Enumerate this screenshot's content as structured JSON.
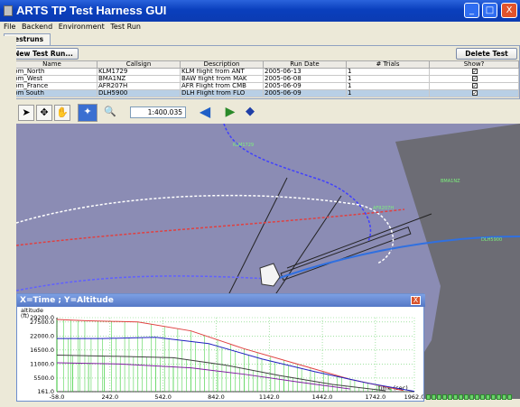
{
  "window": {
    "title": "ARTS TP Test Harness GUI",
    "buttons": {
      "minimize": "_",
      "maximize": "□",
      "close": "X"
    }
  },
  "menu": [
    {
      "label": "File"
    },
    {
      "label": "Backend"
    },
    {
      "label": "Environment"
    },
    {
      "label": "Test Run"
    }
  ],
  "tabs": [
    {
      "label": "Testruns"
    }
  ],
  "runs_panel": {
    "new_button": "New Test Run...",
    "delete_button": "Delete Test Run...",
    "columns": [
      "Name",
      "Callsign",
      "Description",
      "Run Date",
      "# Trials",
      "Show?"
    ],
    "rows": [
      {
        "name": "From_North",
        "callsign": "KLM1729",
        "description": "KLM flight from ANT",
        "date": "2005-06-13",
        "trials": "1",
        "show": true
      },
      {
        "name": "From_West",
        "callsign": "BMA1NZ",
        "description": "BAW flight from MAK",
        "date": "2005-06-08",
        "trials": "1",
        "show": true
      },
      {
        "name": "From_France",
        "callsign": "AFR207H",
        "description": "AFR Flight from CMB",
        "date": "2005-06-09",
        "trials": "1",
        "show": true
      },
      {
        "name": "From South",
        "callsign": "DLH5900",
        "description": "DLH Flight from FLO",
        "date": "2005-06-09",
        "trials": "1",
        "show": true,
        "selected": true
      }
    ]
  },
  "toolbar": {
    "zoom_value": "1:400.035",
    "icons": [
      "pointer-icon",
      "pan-icon",
      "hand-icon",
      "fit-icon",
      "zoom-icon",
      "back-arrow-icon",
      "forward-arrow-icon",
      "layers-icon"
    ]
  },
  "graph": {
    "title": "X=Time ; Y=Altitude",
    "close": "X"
  },
  "chart_data": {
    "type": "line",
    "title": "X=Time ; Y=Altitude",
    "ylabel": "altitude",
    "ylabel_unit": "(ft)",
    "xlabel": "time (sec)",
    "x_ticks": [
      -58.0,
      242.0,
      542.0,
      842.0,
      1142.0,
      1442.0,
      1742.0,
      1962.0
    ],
    "x_tick_labels": [
      "-58.0",
      "242.0",
      "542.0",
      "842.0",
      "1142.0",
      "1442.0",
      "1742.0",
      "1962.0"
    ],
    "y_ticks": [
      161.0,
      5500.0,
      11000.0,
      16500.0,
      22000.0,
      27500.0,
      29200.0
    ],
    "y_tick_labels": [
      "161.0",
      "5500.0",
      "11000.0",
      "16500.0",
      "22000.0",
      "27500.0",
      "29200.0"
    ],
    "xlim": [
      -58,
      1962
    ],
    "ylim": [
      161,
      29200
    ],
    "grid": true,
    "series": [
      {
        "color": "#e04040",
        "x": [
          -58,
          100,
          400,
          700,
          1000,
          1300,
          1600,
          1900
        ],
        "y": [
          28500,
          28000,
          27500,
          24000,
          17000,
          11000,
          5000,
          600
        ]
      },
      {
        "color": "#2020c0",
        "x": [
          -58,
          200,
          500,
          800,
          1100,
          1400,
          1700,
          1962
        ],
        "y": [
          21000,
          21000,
          21500,
          19000,
          13000,
          8000,
          3500,
          300
        ]
      },
      {
        "color": "#404040",
        "x": [
          -58,
          300,
          600,
          900,
          1200,
          1500,
          1800
        ],
        "y": [
          14500,
          14000,
          13500,
          10500,
          6500,
          3000,
          500
        ]
      },
      {
        "color": "#8020a0",
        "x": [
          -58,
          300,
          700,
          1000,
          1300,
          1600
        ],
        "y": [
          11500,
          11000,
          9500,
          7000,
          4000,
          1200
        ]
      }
    ]
  },
  "map_labels": [
    "KLM1729",
    "BMA1NZ",
    "AFR207H",
    "DLH5900"
  ]
}
